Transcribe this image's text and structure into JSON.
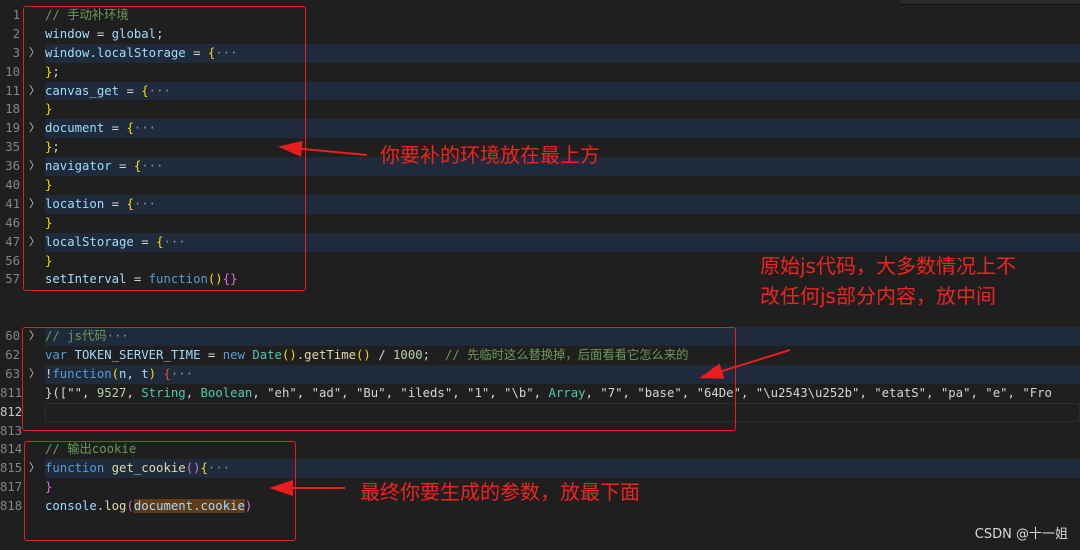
{
  "editor": {
    "lines": [
      {
        "num": "1",
        "fold": false,
        "tokens": [
          [
            "// 手动补环境",
            "com"
          ]
        ]
      },
      {
        "num": "2",
        "fold": false,
        "tokens": [
          [
            "window",
            "var"
          ],
          [
            " = ",
            "txt"
          ],
          [
            "global",
            "var"
          ],
          [
            ";",
            "txt"
          ]
        ]
      },
      {
        "num": "3",
        "fold": true,
        "tokens": [
          [
            "window",
            "var"
          ],
          [
            ".",
            "txt"
          ],
          [
            "localStorage",
            "var"
          ],
          [
            " = ",
            "txt"
          ],
          [
            "{",
            "br"
          ],
          [
            "···",
            "ell"
          ]
        ]
      },
      {
        "num": "10",
        "fold": false,
        "tokens": [
          [
            "}",
            "br"
          ],
          [
            ";",
            "txt"
          ]
        ]
      },
      {
        "num": "11",
        "fold": true,
        "tokens": [
          [
            "canvas_get",
            "var"
          ],
          [
            " = ",
            "txt"
          ],
          [
            "{",
            "br"
          ],
          [
            "···",
            "ell"
          ]
        ]
      },
      {
        "num": "18",
        "fold": false,
        "tokens": [
          [
            "}",
            "br"
          ]
        ]
      },
      {
        "num": "19",
        "fold": true,
        "tokens": [
          [
            "document",
            "var"
          ],
          [
            " = ",
            "txt"
          ],
          [
            "{",
            "br"
          ],
          [
            "···",
            "ell"
          ]
        ]
      },
      {
        "num": "35",
        "fold": false,
        "tokens": [
          [
            "}",
            "br"
          ],
          [
            ";",
            "txt"
          ]
        ]
      },
      {
        "num": "36",
        "fold": true,
        "tokens": [
          [
            "navigator",
            "var"
          ],
          [
            " = ",
            "txt"
          ],
          [
            "{",
            "br"
          ],
          [
            "···",
            "ell"
          ]
        ]
      },
      {
        "num": "40",
        "fold": false,
        "tokens": [
          [
            "}",
            "br"
          ]
        ]
      },
      {
        "num": "41",
        "fold": true,
        "tokens": [
          [
            "location",
            "var"
          ],
          [
            " = ",
            "txt"
          ],
          [
            "{",
            "br"
          ],
          [
            "···",
            "ell"
          ]
        ]
      },
      {
        "num": "46",
        "fold": false,
        "tokens": [
          [
            "}",
            "br"
          ]
        ]
      },
      {
        "num": "47",
        "fold": true,
        "tokens": [
          [
            "localStorage",
            "var"
          ],
          [
            " = ",
            "txt"
          ],
          [
            "{",
            "br"
          ],
          [
            "···",
            "ell"
          ]
        ]
      },
      {
        "num": "56",
        "fold": false,
        "tokens": [
          [
            "}",
            "br"
          ]
        ]
      },
      {
        "num": "57",
        "fold": false,
        "tokens": [
          [
            "setInterval",
            "var"
          ],
          [
            " = ",
            "txt"
          ],
          [
            "function",
            "kw"
          ],
          [
            "()",
            "br"
          ],
          [
            "{}",
            "pa"
          ]
        ]
      },
      {
        "num": "",
        "fold": false,
        "tokens": []
      },
      {
        "num": "",
        "fold": false,
        "tokens": []
      },
      {
        "num": "60",
        "fold": true,
        "tokens": [
          [
            "// js代码",
            "com"
          ],
          [
            "···",
            "ell"
          ]
        ]
      },
      {
        "num": "62",
        "fold": false,
        "tokens": [
          [
            "var",
            "kw"
          ],
          [
            " ",
            "txt"
          ],
          [
            "TOKEN_SERVER_TIME",
            "var"
          ],
          [
            " = ",
            "txt"
          ],
          [
            "new",
            "kw"
          ],
          [
            " ",
            "txt"
          ],
          [
            "Date",
            "cls"
          ],
          [
            "()",
            "br"
          ],
          [
            ".",
            "txt"
          ],
          [
            "getTime",
            "fn"
          ],
          [
            "()",
            "br"
          ],
          [
            " / ",
            "txt"
          ],
          [
            "1000",
            "num"
          ],
          [
            ";  ",
            "txt"
          ],
          [
            "// 先临时这么替换掉，后面看看它怎么来的",
            "com"
          ]
        ]
      },
      {
        "num": "63",
        "fold": true,
        "tokens": [
          [
            "!",
            "txt"
          ],
          [
            "function",
            "kw"
          ],
          [
            "(",
            "br"
          ],
          [
            "n",
            "var"
          ],
          [
            ", ",
            "txt"
          ],
          [
            "t",
            "var"
          ],
          [
            ")",
            "br"
          ],
          [
            " ",
            "txt"
          ],
          [
            "{",
            "red"
          ],
          [
            "···",
            "ell"
          ]
        ]
      },
      {
        "num": "811",
        "fold": false,
        "tokens": [
          [
            "}([",
            "txt"
          ],
          [
            "\"\"",
            "txt"
          ],
          [
            ", ",
            "txt"
          ],
          [
            "9527",
            "num"
          ],
          [
            ", ",
            "txt"
          ],
          [
            "String",
            "cls"
          ],
          [
            ", ",
            "txt"
          ],
          [
            "Boolean",
            "cls"
          ],
          [
            ", \"eh\", \"ad\", \"Bu\", \"ileds\", \"1\", \"\\b\", ",
            "txt"
          ],
          [
            "Array",
            "cls"
          ],
          [
            ", \"7\", \"base\", \"64De\", \"\\u2543\\u252b\", \"etatS\", \"pa\", \"e\", \"Fro",
            "txt"
          ]
        ]
      },
      {
        "num": "812",
        "fold": false,
        "current": true,
        "tokens": []
      },
      {
        "num": "813",
        "fold": false,
        "tokens": []
      },
      {
        "num": "814",
        "fold": false,
        "tokens": [
          [
            "// 输出cookie",
            "com"
          ]
        ]
      },
      {
        "num": "815",
        "fold": true,
        "tokens": [
          [
            "function",
            "kw"
          ],
          [
            " ",
            "txt"
          ],
          [
            "get_cookie",
            "fn"
          ],
          [
            "()",
            "pa"
          ],
          [
            "{",
            "br"
          ],
          [
            "···",
            "ell"
          ]
        ]
      },
      {
        "num": "817",
        "fold": false,
        "tokens": [
          [
            "}",
            "pa"
          ]
        ]
      },
      {
        "num": "818",
        "fold": false,
        "tokens": [
          [
            "console",
            "var"
          ],
          [
            ".",
            "txt"
          ],
          [
            "log",
            "fn"
          ],
          [
            "(",
            "pa"
          ],
          [
            "document.cookie",
            "hl"
          ],
          [
            ")",
            "pa"
          ]
        ]
      }
    ]
  },
  "annotations": {
    "top": "你要补的环境放在最上方",
    "middle_line1": "原始js代码，大多数情况上不",
    "middle_line2": "改任何js部分内容，放中间",
    "bottom": "最终你要生成的参数，放最下面",
    "color": "#f2231f"
  },
  "watermark": "CSDN @十一姐"
}
